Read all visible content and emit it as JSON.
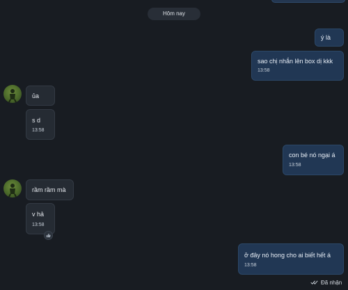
{
  "date_separator": "Hôm nay",
  "messages": [
    {
      "side": "out",
      "text": "ý là",
      "time": ""
    },
    {
      "side": "out",
      "text": "sao chị nhắn lên box dị kkk",
      "time": "13:58"
    },
    {
      "side": "in",
      "text": "ủa",
      "time": ""
    },
    {
      "side": "in",
      "text": "s d",
      "time": "13:58"
    },
    {
      "side": "out",
      "text": "con bé nó ngại á",
      "time": "13:58"
    },
    {
      "side": "in",
      "text": "rầm rầm mà",
      "time": ""
    },
    {
      "side": "in",
      "text": "v hả",
      "time": "13:58"
    },
    {
      "side": "out",
      "text": "ở đây nó hong cho ai biết hết á",
      "time": "13:58"
    }
  ],
  "status_text": "Đã nhận",
  "icons": {
    "read_receipt": "double-check-icon",
    "reaction": "thumbs-up-icon",
    "avatar": "avatar-photo"
  },
  "colors": {
    "background": "#181c22",
    "outgoing_bubble": "#213754",
    "incoming_bubble": "#252b33"
  }
}
